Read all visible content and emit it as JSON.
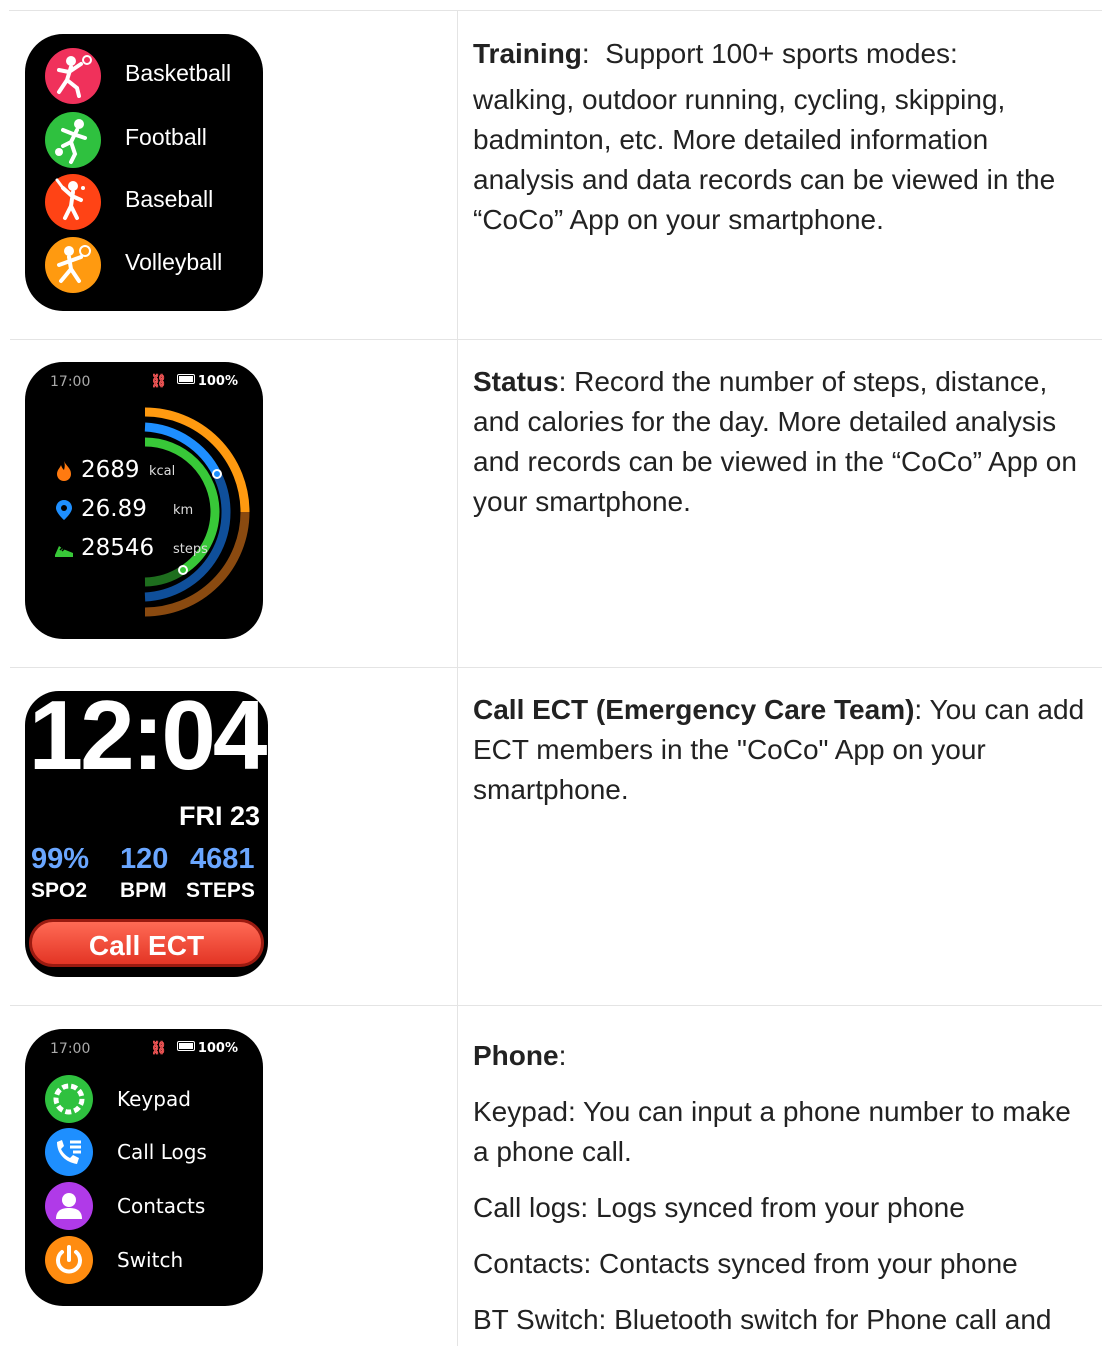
{
  "training": {
    "items": [
      {
        "label": "Basketball",
        "icon": "basketball-player-icon",
        "color": "#f0315b"
      },
      {
        "label": "Football",
        "icon": "football-player-icon",
        "color": "#2fc13f"
      },
      {
        "label": "Baseball",
        "icon": "baseball-player-icon",
        "color": "#ff4315"
      },
      {
        "label": "Volleyball",
        "icon": "volleyball-player-icon",
        "color": "#ff9a10"
      }
    ],
    "heading": "Training",
    "text_first": "Support 100+ sports modes:",
    "text_rest": "walking, outdoor running, cycling, skipping, badminton, etc. More detailed information analysis and data records can be viewed in the “CoCo” App on your smartphone."
  },
  "status": {
    "status_bar": {
      "time": "17:00",
      "battery": "100%"
    },
    "stats": [
      {
        "value": "2689",
        "unit": "kcal",
        "icon": "flame-icon"
      },
      {
        "value": "26.89",
        "unit": "km",
        "icon": "location-pin-icon"
      },
      {
        "value": "28546",
        "unit": "steps",
        "icon": "shoe-icon"
      }
    ],
    "ring_colors": {
      "calories": "#ff9a10",
      "distance": "#1e8fff",
      "steps": "#38c838"
    },
    "heading": "Status",
    "text": ": Record the number of steps, distance, and calories for the day. More detailed analysis and records can be viewed in the “CoCo” App on your smartphone."
  },
  "ect": {
    "time": "12:04",
    "date": "FRI 23",
    "metrics": [
      {
        "value": "99%",
        "label": "SPO2"
      },
      {
        "value": "120",
        "label": "BPM"
      },
      {
        "value": "4681",
        "label": "STEPS"
      }
    ],
    "button": "Call ECT",
    "heading": "Call ECT (Emergency Care Team)",
    "text": ": You can add ECT members in the \"CoCo\" App on your smartphone."
  },
  "phone": {
    "status_bar": {
      "time": "17:00",
      "battery": "100%"
    },
    "items": [
      {
        "label": "Keypad",
        "icon": "keypad-icon",
        "color": "#2fc13f"
      },
      {
        "label": "Call Logs",
        "icon": "call-log-icon",
        "color": "#1e8fff"
      },
      {
        "label": "Contacts",
        "icon": "contact-person-icon",
        "color": "#b03ae8"
      },
      {
        "label": "Switch",
        "icon": "power-icon",
        "color": "#ff8c10"
      }
    ],
    "heading": "Phone",
    "paragraphs": [
      "Keypad: You can input a phone number to make a phone call.",
      "Call logs: Logs synced from your phone",
      "Contacts: Contacts synced from your phone",
      "BT Switch: Bluetooth switch for Phone call and"
    ]
  }
}
